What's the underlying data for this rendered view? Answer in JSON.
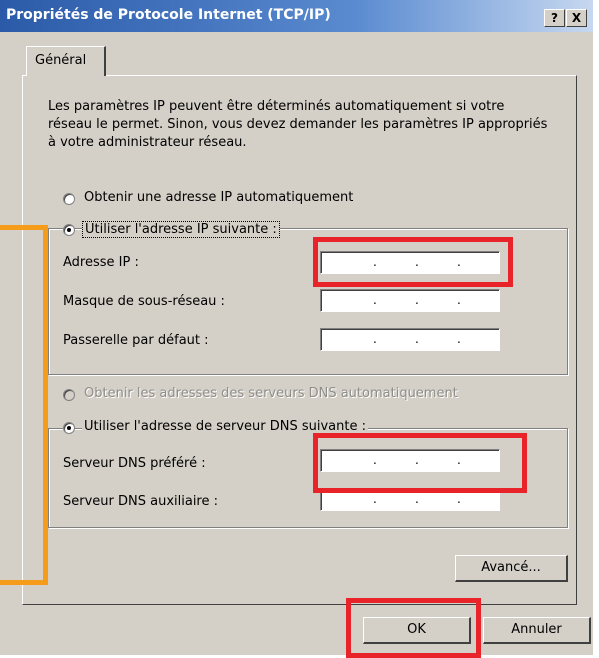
{
  "window": {
    "title": "Propriétés de Protocole Internet (TCP/IP)",
    "help_button": "?",
    "close_button": "X"
  },
  "tab": {
    "label": "Général"
  },
  "intro_text": "Les paramètres IP peuvent être déterminés automatiquement si votre réseau le permet. Sinon, vous devez demander les paramètres IP appropriés à votre administrateur réseau.",
  "ip": {
    "auto_label": "Obtenir une adresse IP automatiquement",
    "manual_label": "Utiliser l'adresse IP suivante :",
    "selected": "manual",
    "fields": [
      {
        "label": "Adresse IP :",
        "value": ""
      },
      {
        "label": "Masque de sous-réseau :",
        "value": ""
      },
      {
        "label": "Passerelle par défaut :",
        "value": ""
      }
    ]
  },
  "dns": {
    "auto_label": "Obtenir les adresses des serveurs DNS automatiquement",
    "auto_disabled": true,
    "manual_label": "Utiliser l'adresse de serveur DNS suivante :",
    "selected": "manual",
    "fields": [
      {
        "label": "Serveur DNS préféré :",
        "value": ""
      },
      {
        "label": "Serveur DNS auxiliaire :",
        "value": ""
      }
    ]
  },
  "buttons": {
    "advanced": "Avancé...",
    "ok": "OK",
    "cancel": "Annuler"
  },
  "colors": {
    "highlight_red": "#e8232a",
    "highlight_orange": "#f59c1a",
    "title_blue": "#2b5aa8"
  }
}
